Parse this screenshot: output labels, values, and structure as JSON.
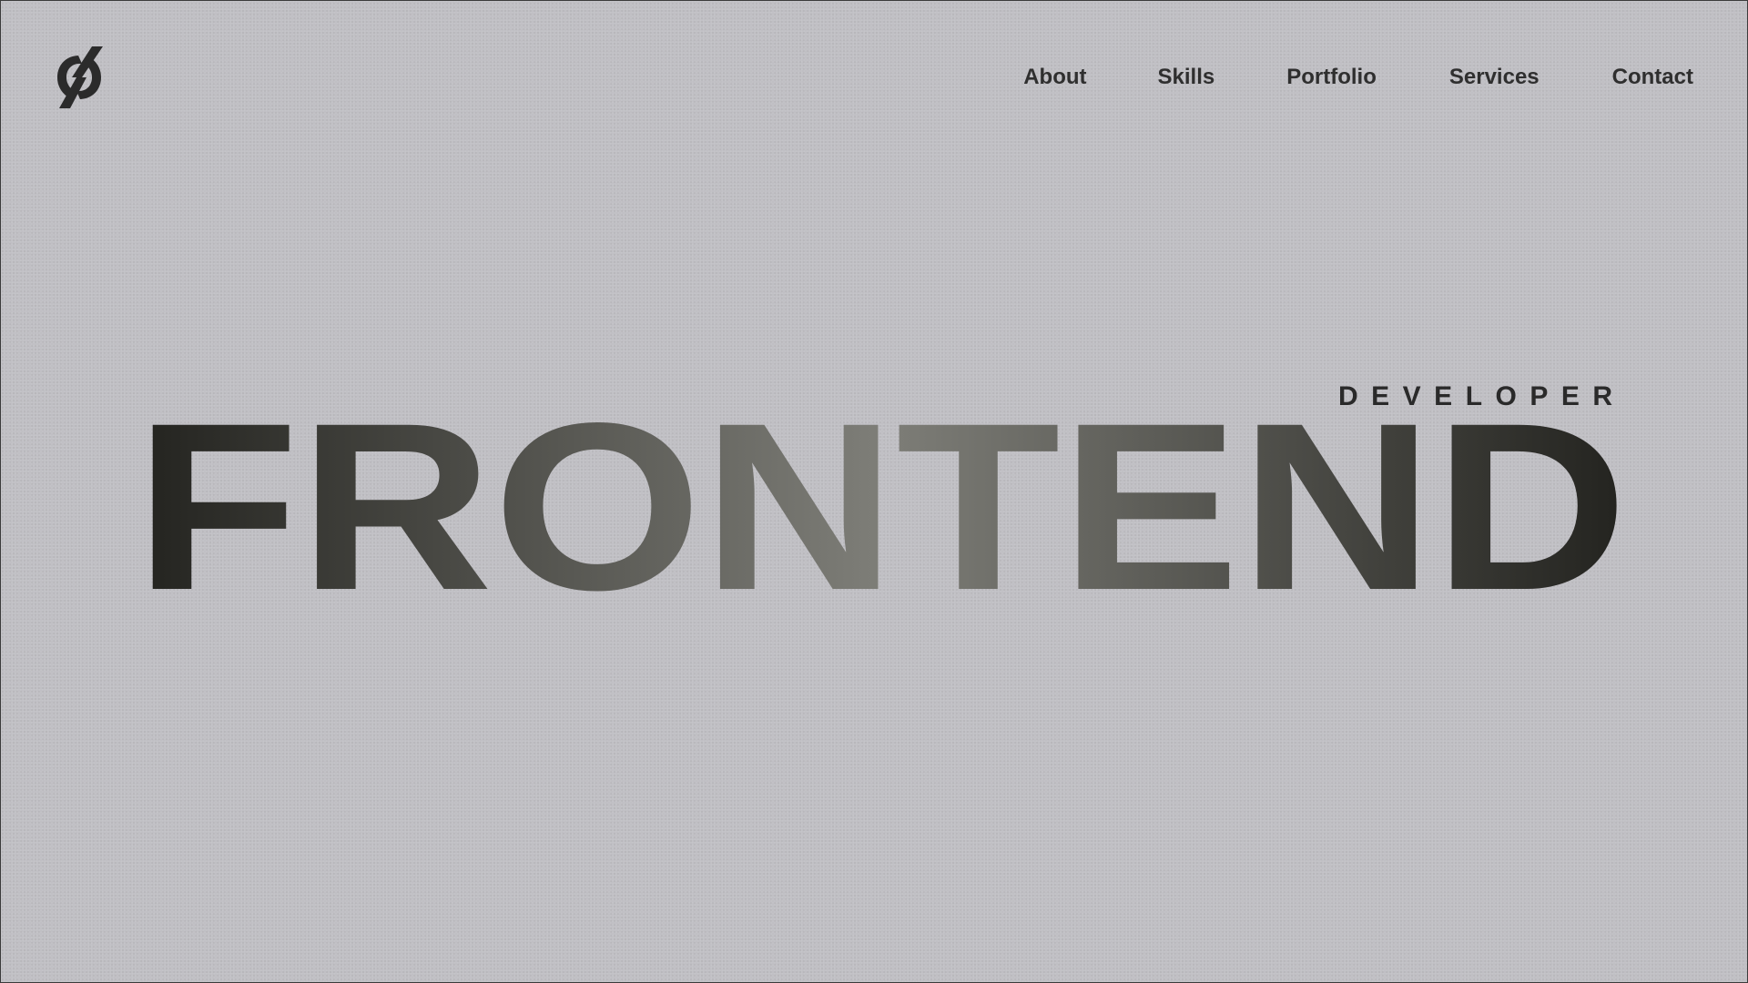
{
  "logo": {
    "icon": "power-bolt-logo-icon"
  },
  "nav": {
    "items": [
      {
        "label": "About"
      },
      {
        "label": "Skills"
      },
      {
        "label": "Portfolio"
      },
      {
        "label": "Services"
      },
      {
        "label": "Contact"
      }
    ]
  },
  "hero": {
    "subtitle": "DEVELOPER",
    "headline": "FRONTEND"
  },
  "colors": {
    "background": "#c0bfc4",
    "text_dark": "#2f2f2f",
    "gradient_edge": "#23231f",
    "gradient_center": "#7e7e78"
  }
}
